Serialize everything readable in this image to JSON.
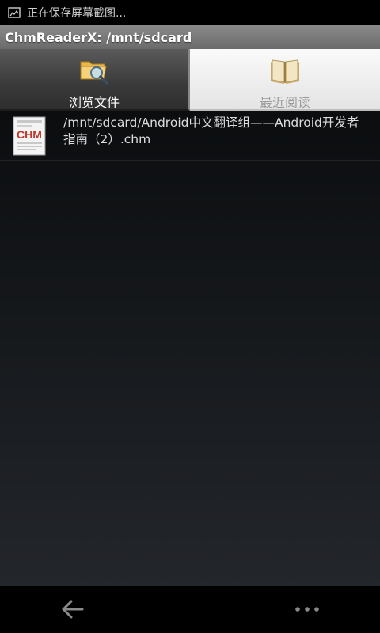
{
  "status_bar": {
    "notification_icon": "screenshot-icon",
    "notification_text": "正在保存屏幕截图..."
  },
  "app": {
    "title": "ChmReaderX: /mnt/sdcard"
  },
  "tabs": [
    {
      "label": "浏览文件",
      "icon": "folder-search-icon",
      "selected": true
    },
    {
      "label": "最近阅读",
      "icon": "open-book-icon",
      "selected": false
    }
  ],
  "files": [
    {
      "name": "/mnt/sdcard/Android中文翻译组——Android开发者指南（2）.chm",
      "icon": "chm-file-icon",
      "icon_text": "CHM"
    }
  ],
  "nav": {
    "back_icon": "back-arrow-icon",
    "menu_icon": "more-options-icon"
  },
  "colors": {
    "title_bar": "#7a7a7a",
    "selected_tab": "#3a3a3a",
    "unselected_tab": "#eeeeee",
    "list_background": "#15181b",
    "chm_red": "#c0392b"
  }
}
